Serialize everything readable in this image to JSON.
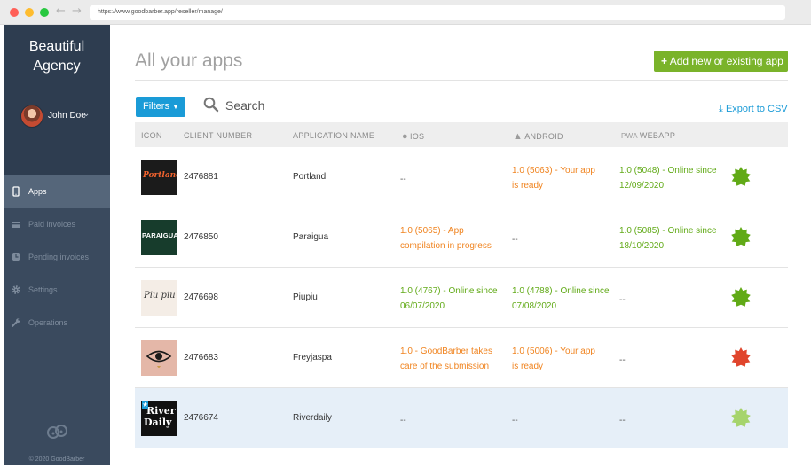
{
  "browser": {
    "url": "https://www.goodbarber.app/reseller/manage/"
  },
  "sidebar": {
    "brand_line1": "Beautiful",
    "brand_line2": "Agency",
    "user_name": "John Doe",
    "items": [
      {
        "label": "Apps",
        "icon": "tablet-icon",
        "active": true
      },
      {
        "label": "Paid invoices",
        "icon": "credit-card-icon",
        "active": false
      },
      {
        "label": "Pending invoices",
        "icon": "clock-icon",
        "active": false
      },
      {
        "label": "Settings",
        "icon": "gear-icon",
        "active": false
      },
      {
        "label": "Operations",
        "icon": "wrench-icon",
        "active": false
      }
    ],
    "copyright": "© 2020 GoodBarber"
  },
  "main": {
    "title": "All your apps",
    "add_button": "Add new or existing app",
    "filters_button": "Filters",
    "search_label": "Search",
    "export_link": "Export to CSV"
  },
  "table": {
    "headers": {
      "icon": "ICON",
      "client_number": "CLIENT NUMBER",
      "application_name": "APPLICATION NAME",
      "ios": "IOS",
      "android": "ANDROID",
      "webapp": "WEBAPP"
    },
    "rows": [
      {
        "icon_text": "Portland",
        "client_number": "2476881",
        "name": "Portland",
        "ios": "--",
        "android_l1": "1.0 (5063) - Your app",
        "android_l2": "is ready",
        "webapp_l1": "1.0 (5048) - Online since",
        "webapp_l2": "12/09/2020",
        "status_color": "#61aa17"
      },
      {
        "icon_text": "PARAIGUA",
        "client_number": "2476850",
        "name": "Paraigua",
        "ios_l1": "1.0 (5065) - App",
        "ios_l2": "compilation in progress",
        "android": "--",
        "webapp_l1": "1.0 (5085) - Online since",
        "webapp_l2": "18/10/2020",
        "status_color": "#61aa17"
      },
      {
        "icon_text": "Piu piu",
        "client_number": "2476698",
        "name": "Piupiu",
        "ios_l1": "1.0 (4767) - Online since",
        "ios_l2": "06/07/2020",
        "android_l1": "1.0 (4788) - Online since",
        "android_l2": "07/08/2020",
        "webapp": "--",
        "status_color": "#61aa17"
      },
      {
        "client_number": "2476683",
        "name": "Freyjaspa",
        "ios_l1": "1.0 - GoodBarber takes",
        "ios_l2": "care of the submission",
        "android_l1": "1.0 (5006) - Your app",
        "android_l2": "is ready",
        "webapp": "--",
        "status_color": "#e0452c"
      },
      {
        "icon_text_l1": "River",
        "icon_text_l2": "Daily",
        "client_number": "2476674",
        "name": "Riverdaily",
        "ios": "--",
        "android": "--",
        "webapp": "--",
        "status_color": "#a6d46c"
      }
    ]
  },
  "colors": {
    "sidebar_bg": "#3a4a5e",
    "accent_blue": "#1a9bd7",
    "add_green": "#7ab32a",
    "status_orange": "#f08420",
    "status_green": "#61aa17"
  }
}
